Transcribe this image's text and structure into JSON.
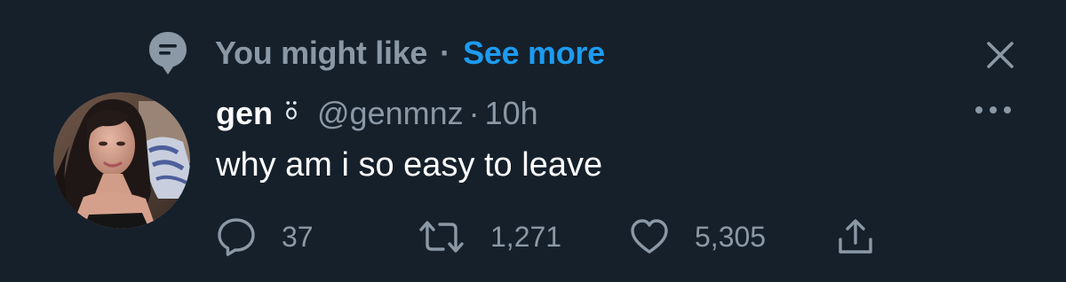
{
  "colors": {
    "background": "#15202b",
    "primary_text": "#ffffff",
    "secondary_text": "#8b98a5",
    "accent": "#1d9bf0"
  },
  "suggestion": {
    "icon": "speech-bubble-icon",
    "label": "You might like",
    "separator": "·",
    "see_more_label": "See more",
    "close_icon": "close-icon"
  },
  "tweet": {
    "author": {
      "display_name": "gen",
      "name_emoji": "surprised-face-emoji",
      "handle": "@genmnz",
      "avatar": "profile-photo"
    },
    "time_separator": "·",
    "timestamp": "10h",
    "more_icon": "more-options-icon",
    "text": "why am i so easy to leave",
    "actions": {
      "reply": {
        "icon": "reply-icon",
        "count": "37"
      },
      "retweet": {
        "icon": "retweet-icon",
        "count": "1,271"
      },
      "like": {
        "icon": "heart-icon",
        "count": "5,305"
      },
      "share": {
        "icon": "share-icon"
      }
    }
  }
}
